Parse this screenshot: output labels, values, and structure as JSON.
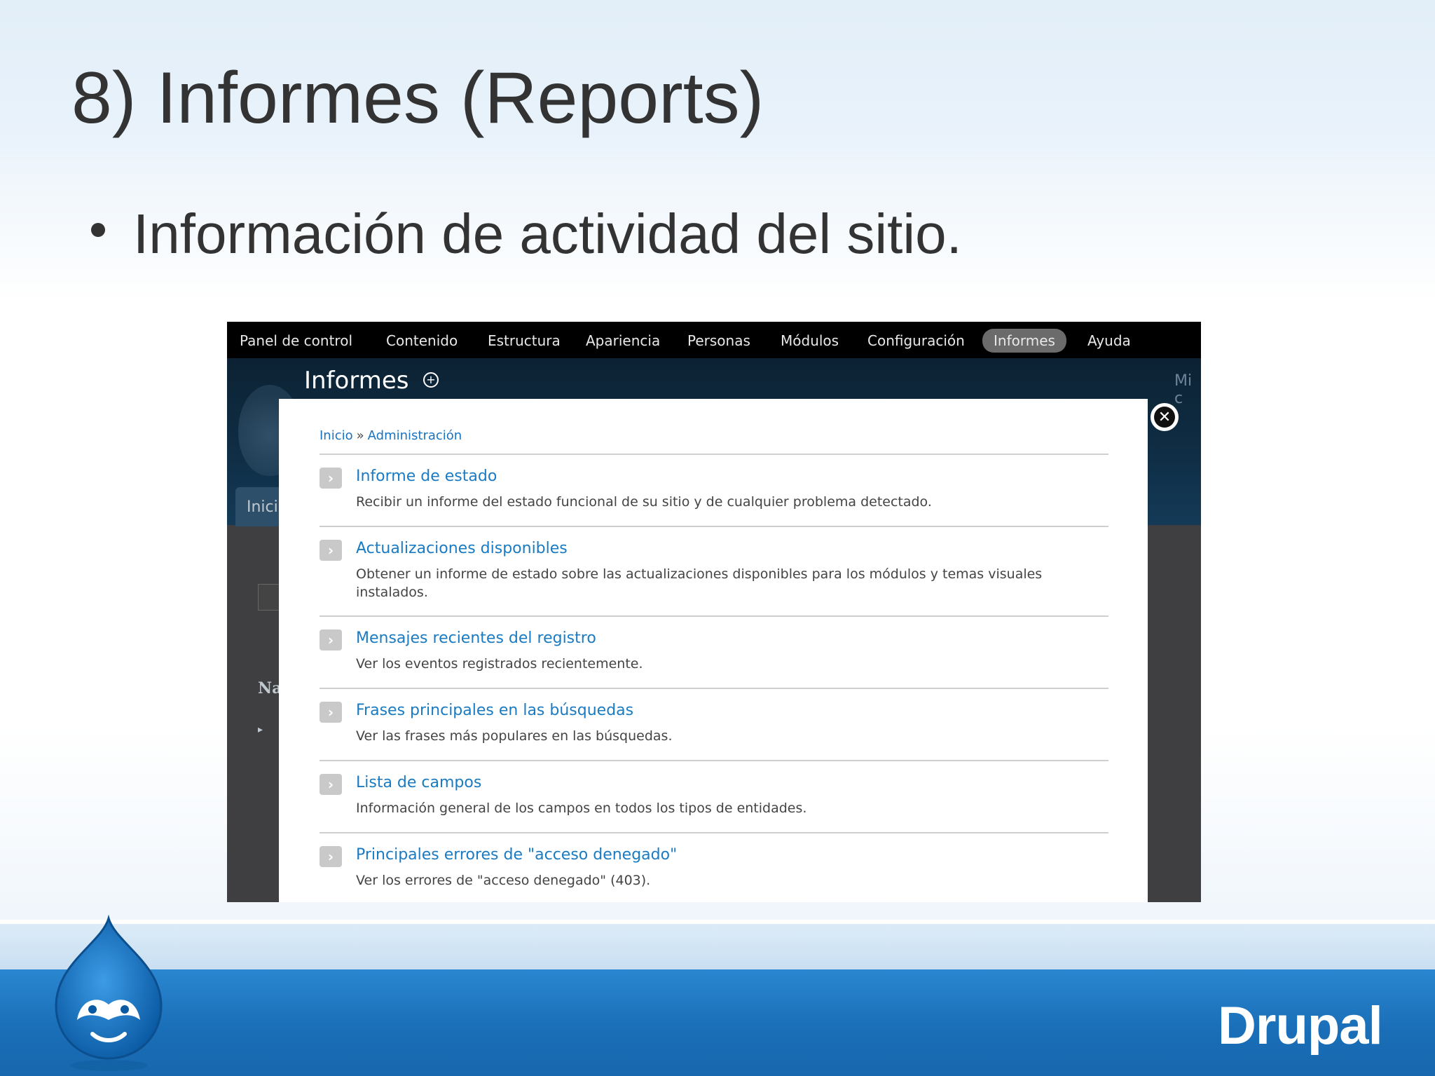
{
  "slide": {
    "title": "8) Informes (Reports)",
    "bullet": "Información de actividad del sitio.",
    "footer_wordmark": "Drupal"
  },
  "toolbar": {
    "items": [
      {
        "label": "Panel de control",
        "active": false
      },
      {
        "label": "Contenido",
        "active": false
      },
      {
        "label": "Estructura",
        "active": false
      },
      {
        "label": "Apariencia",
        "active": false
      },
      {
        "label": "Personas",
        "active": false
      },
      {
        "label": "Módulos",
        "active": false
      },
      {
        "label": "Configuración",
        "active": false
      },
      {
        "label": "Informes",
        "active": true
      },
      {
        "label": "Ayuda",
        "active": false
      }
    ]
  },
  "page": {
    "title": "Informes",
    "add_icon": "plus-circle-icon",
    "background_fragments": [
      "Inici",
      "Na",
      "Mi c"
    ]
  },
  "breadcrumb": {
    "items": [
      "Inicio",
      "Administración"
    ],
    "separator": "»"
  },
  "close_icon": "close-icon",
  "entries": [
    {
      "title": "Informe de estado",
      "description": "Recibir un informe del estado funcional de su sitio y de cualquier problema detectado."
    },
    {
      "title": "Actualizaciones disponibles",
      "description": "Obtener un informe de estado sobre las actualizaciones disponibles para los módulos y temas visuales instalados."
    },
    {
      "title": "Mensajes recientes del registro",
      "description": "Ver los eventos registrados recientemente."
    },
    {
      "title": "Frases principales en las búsquedas",
      "description": "Ver las frases más populares en las búsquedas."
    },
    {
      "title": "Lista de campos",
      "description": "Información general de los campos en todos los tipos de entidades."
    },
    {
      "title": "Principales errores de \"acceso denegado\"",
      "description": "Ver los errores de \"acceso denegado\" (403)."
    }
  ],
  "colors": {
    "link": "#1a7bc2",
    "footer": "#1a6fb8",
    "title_text": "#333333"
  }
}
